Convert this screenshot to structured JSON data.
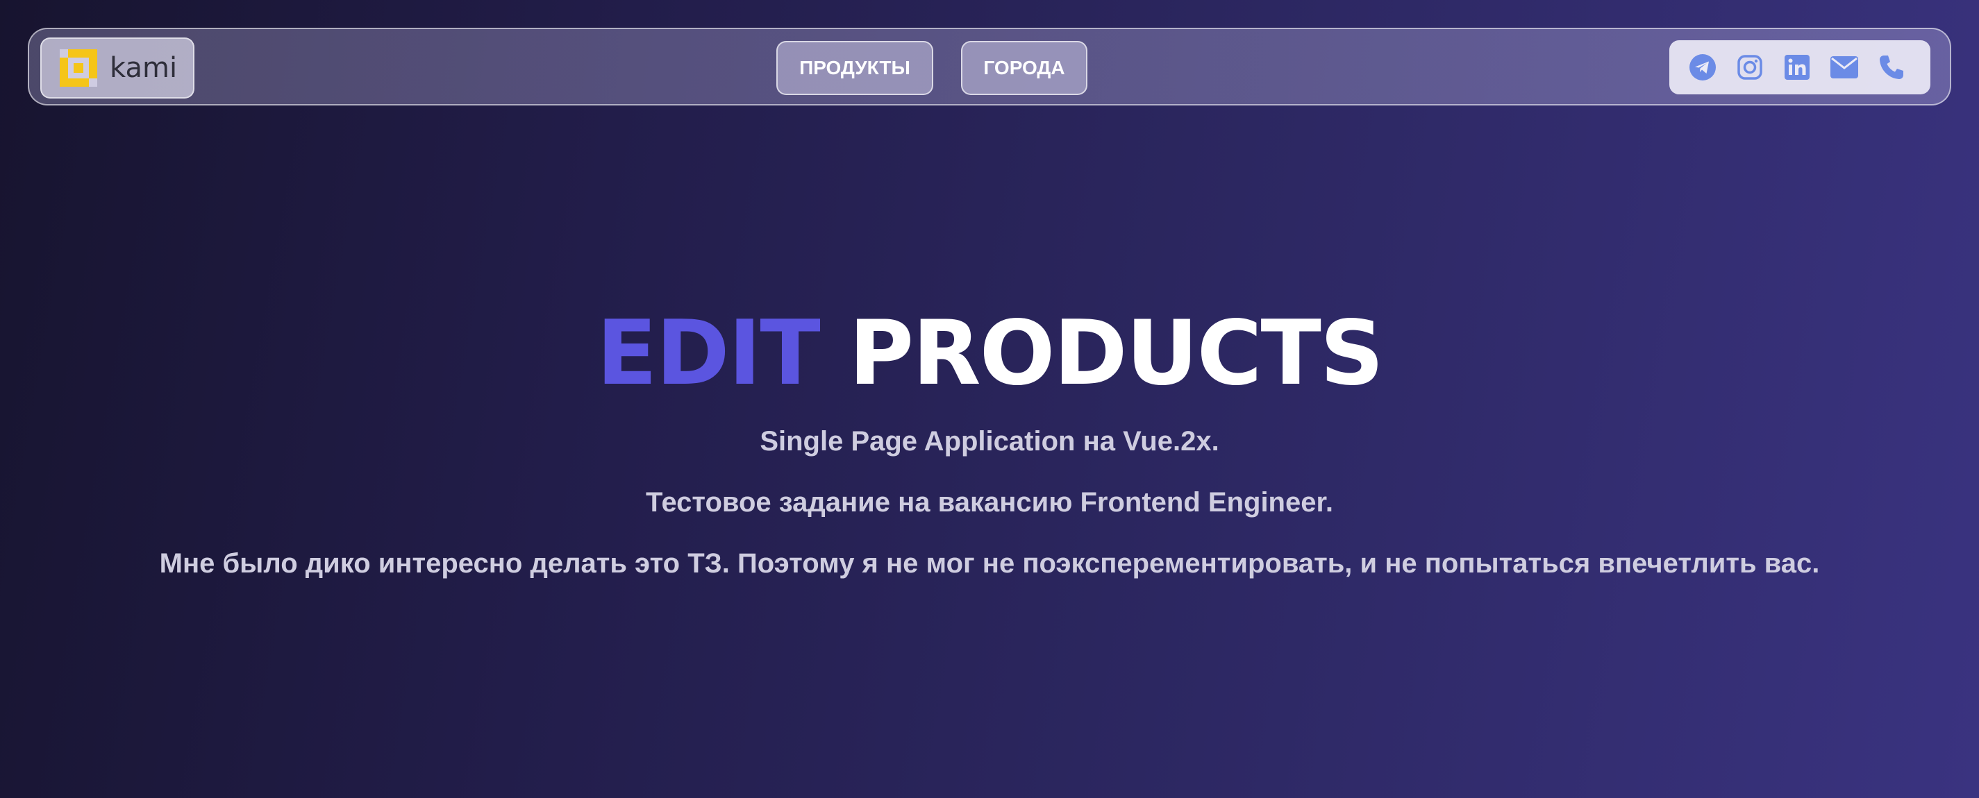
{
  "header": {
    "logo_text": "kami",
    "nav": {
      "products_label": "ПРОДУКТЫ",
      "cities_label": "ГОРОДА"
    },
    "socials": [
      {
        "icon": "telegram-icon"
      },
      {
        "icon": "instagram-icon"
      },
      {
        "icon": "linkedin-icon"
      },
      {
        "icon": "mail-icon"
      },
      {
        "icon": "phone-icon"
      }
    ],
    "social_icon_color": "#6b8be6"
  },
  "hero": {
    "title_accent": "EDIT",
    "title_main": "PRODUCTS",
    "accent_color": "#5b55e0",
    "lines": [
      "Single Page Application на Vue.2x.",
      "Тестовое задание на вакансию Frontend Engineer.",
      "Мне было дико интересно делать это ТЗ. Поэтому я не мог не поэксперементировать, и не попытаться впечетлить вас."
    ]
  },
  "colors": {
    "logo_mark": "#f5c518",
    "hero_text": "#cfcde0"
  }
}
